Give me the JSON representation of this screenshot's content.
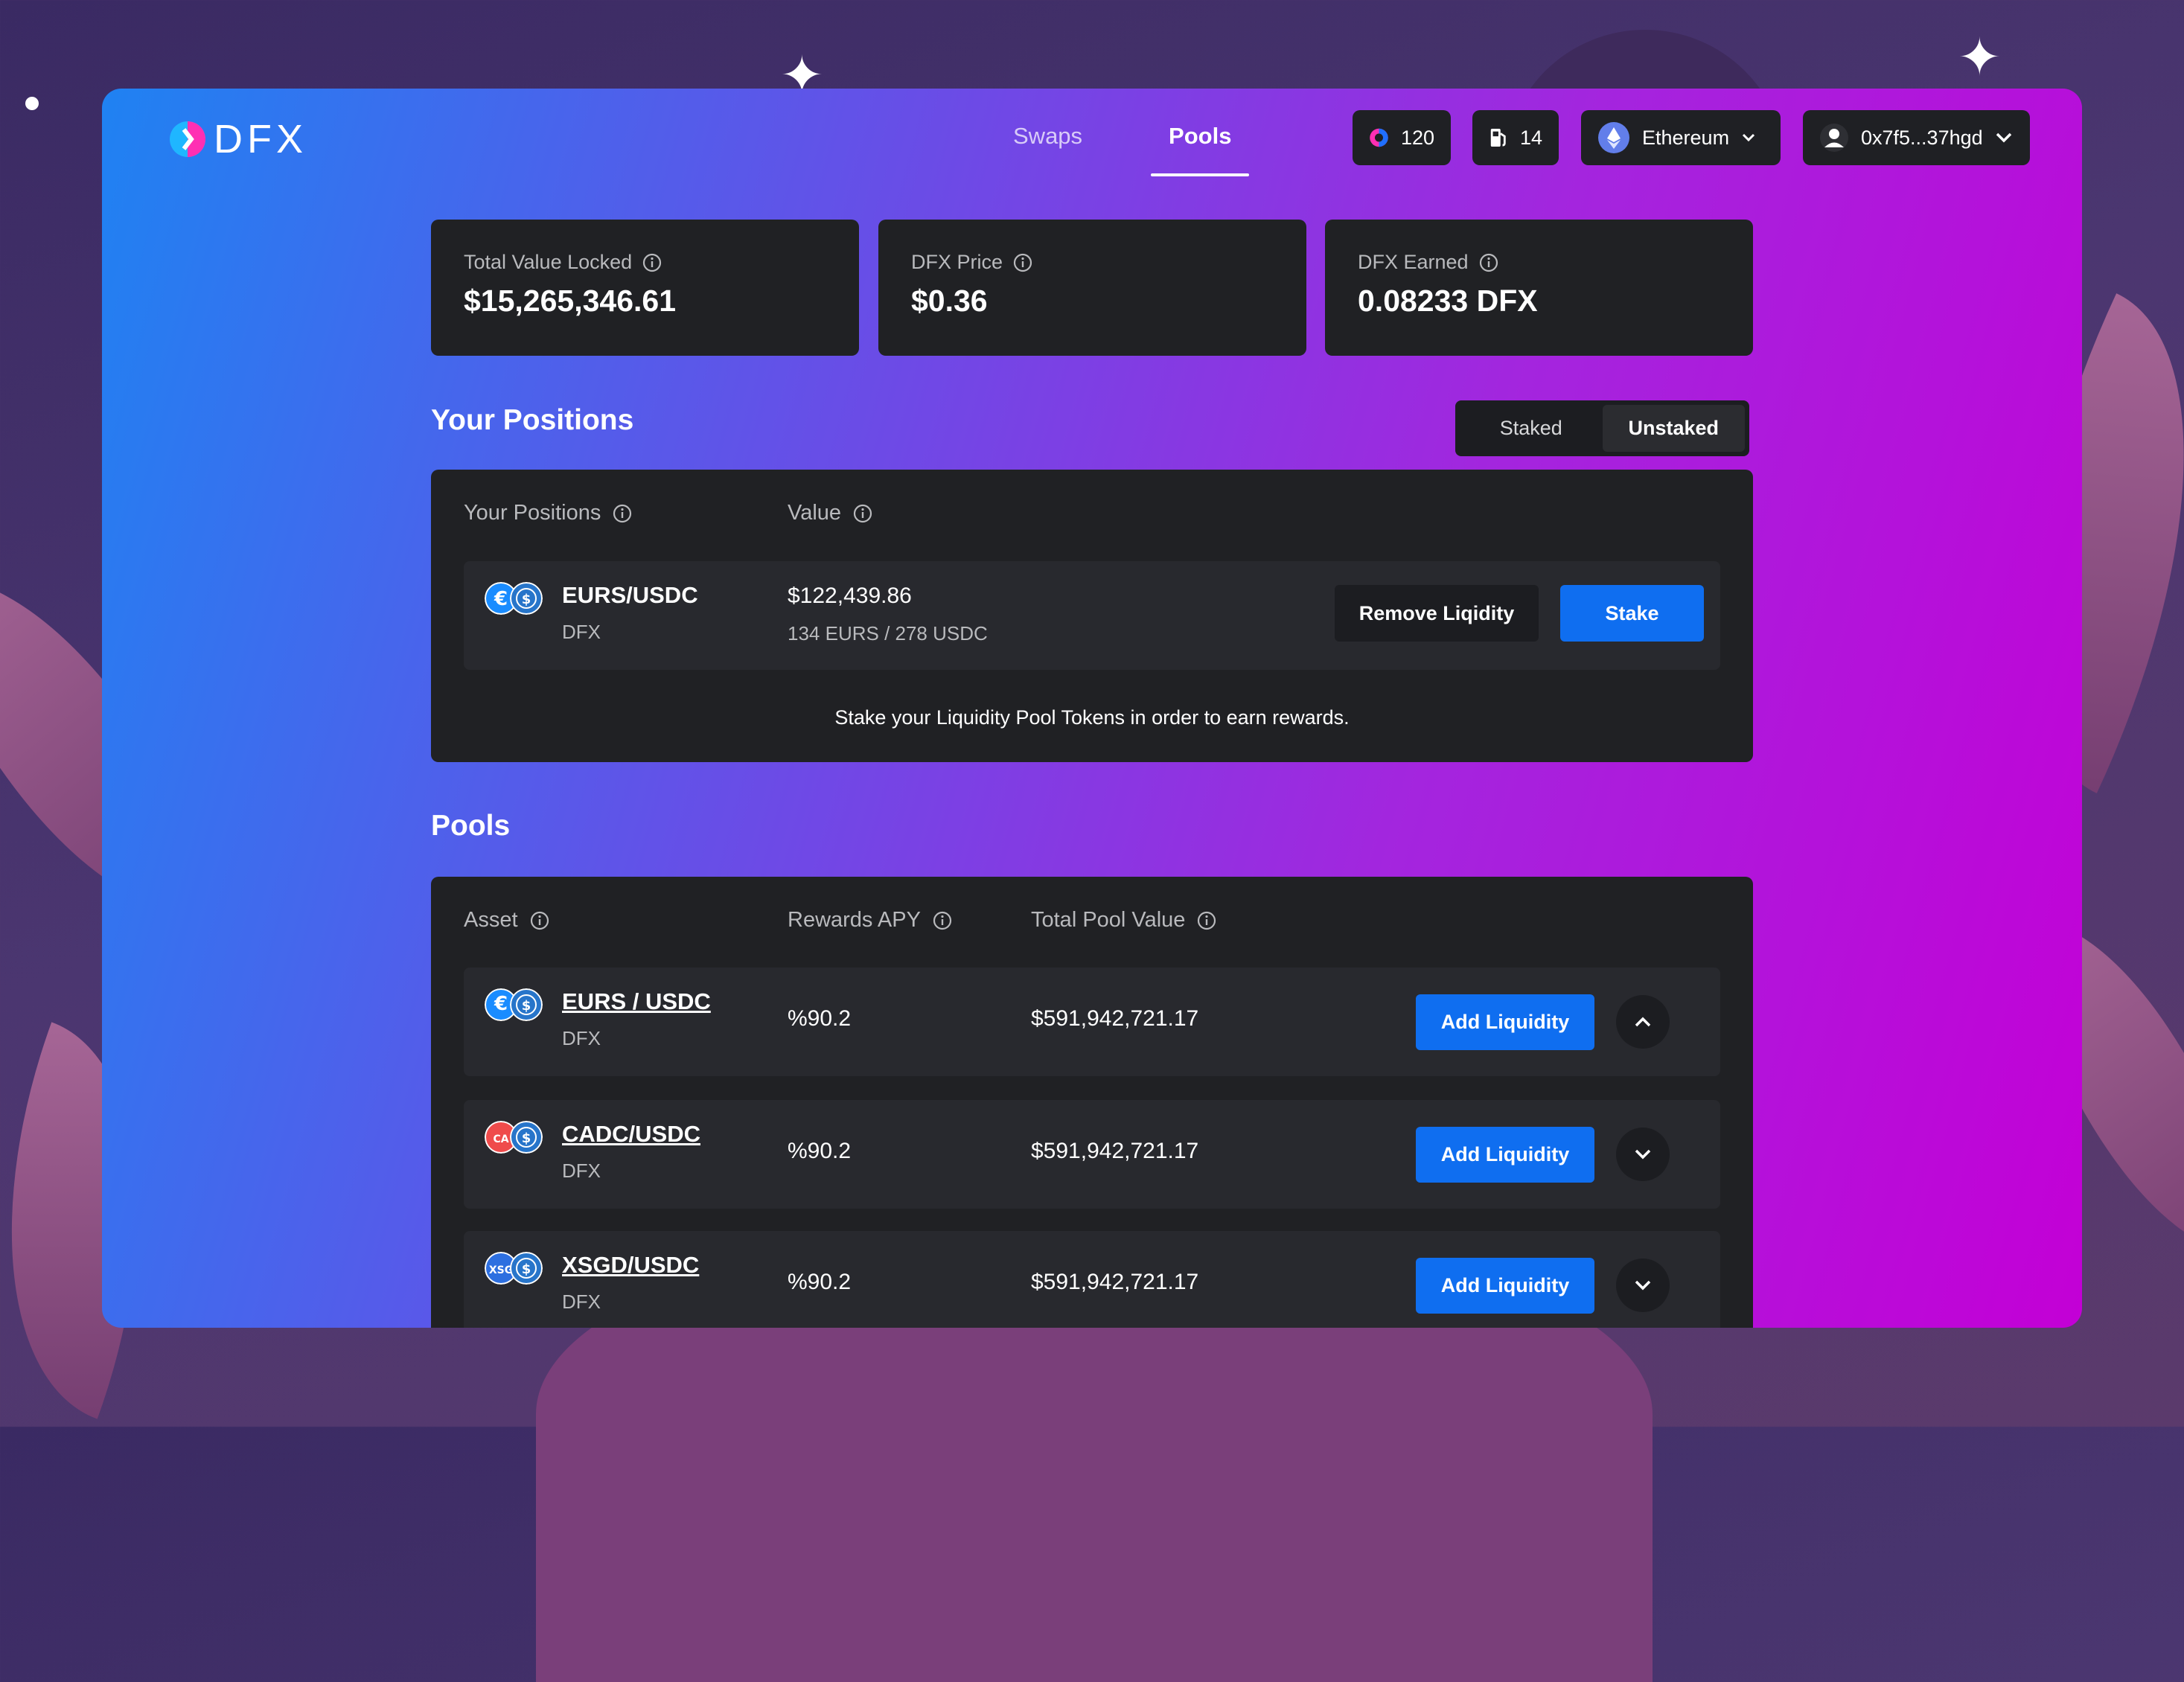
{
  "brand": {
    "name": "DFX"
  },
  "nav": {
    "tabs": [
      {
        "label": "Swaps",
        "active": false
      },
      {
        "label": "Pools",
        "active": true
      }
    ]
  },
  "header": {
    "points": "120",
    "gas": "14",
    "network": "Ethereum",
    "wallet": "0x7f5...37hgd"
  },
  "stats": [
    {
      "label": "Total Value Locked",
      "value": "$15,265,346.61"
    },
    {
      "label": "DFX Price",
      "value": "$0.36"
    },
    {
      "label": "DFX Earned",
      "value": "0.08233 DFX"
    }
  ],
  "positions": {
    "title": "Your Positions",
    "toggle": {
      "staked": "Staked",
      "unstaked": "Unstaked",
      "selected": "Unstaked"
    },
    "columns": {
      "position": "Your Positions",
      "value": "Value"
    },
    "row": {
      "asset": "EURS/USDC",
      "sub": "DFX",
      "value": "$122,439.86",
      "value_detail": "134 EURS / 278 USDC",
      "remove_label": "Remove Liqidity",
      "stake_label": "Stake"
    },
    "note": "Stake your Liquidity Pool Tokens in order to earn rewards."
  },
  "pools": {
    "title": "Pools",
    "columns": {
      "asset": "Asset",
      "apy": "Rewards APY",
      "tpv": "Total Pool Value"
    },
    "add_label": "Add Liquidity",
    "rows": [
      {
        "asset": "EURS / USDC",
        "sub": "DFX",
        "apy": "%90.2",
        "tpv": "$591,942,721.17",
        "coin": "eurs",
        "coin_label": "€",
        "expanded": true
      },
      {
        "asset": "CADC/USDC",
        "sub": "DFX",
        "apy": "%90.2",
        "tpv": "$591,942,721.17",
        "coin": "cadc",
        "coin_label": "CA",
        "expanded": false
      },
      {
        "asset": "XSGD/USDC",
        "sub": "DFX",
        "apy": "%90.2",
        "tpv": "$591,942,721.17",
        "coin": "xsgd",
        "coin_label": "XSG",
        "expanded": false
      }
    ]
  },
  "colors": {
    "accent": "#0f6ef0",
    "card": "#202124",
    "row": "#28292e",
    "gradient_start": "#1f82f2",
    "gradient_end": "#c300d6"
  },
  "icons": [
    "dfx-logo-icon",
    "points-icon",
    "gas-pump-icon",
    "ethereum-icon",
    "avatar-icon",
    "chevron-down-icon",
    "chevron-up-icon",
    "info-icon",
    "eurs-coin-icon",
    "usdc-coin-icon",
    "cadc-coin-icon",
    "xsgd-coin-icon"
  ]
}
